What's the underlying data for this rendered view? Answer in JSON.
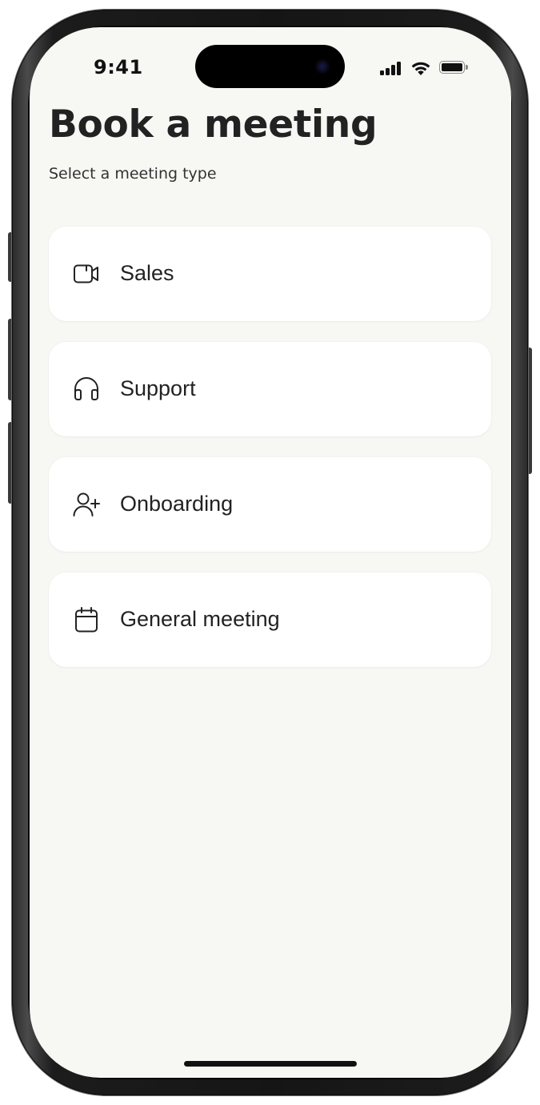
{
  "status_bar": {
    "time": "9:41"
  },
  "header": {
    "title": "Book a meeting",
    "subtitle": "Select a meeting type"
  },
  "meeting_types": [
    {
      "label": "Sales",
      "icon": "video-camera-icon"
    },
    {
      "label": "Support",
      "icon": "headphones-icon"
    },
    {
      "label": "Onboarding",
      "icon": "user-plus-icon"
    },
    {
      "label": "General meeting",
      "icon": "calendar-icon"
    }
  ],
  "colors": {
    "background": "#f7f7f4",
    "card": "#ffffff",
    "text": "#222222"
  }
}
